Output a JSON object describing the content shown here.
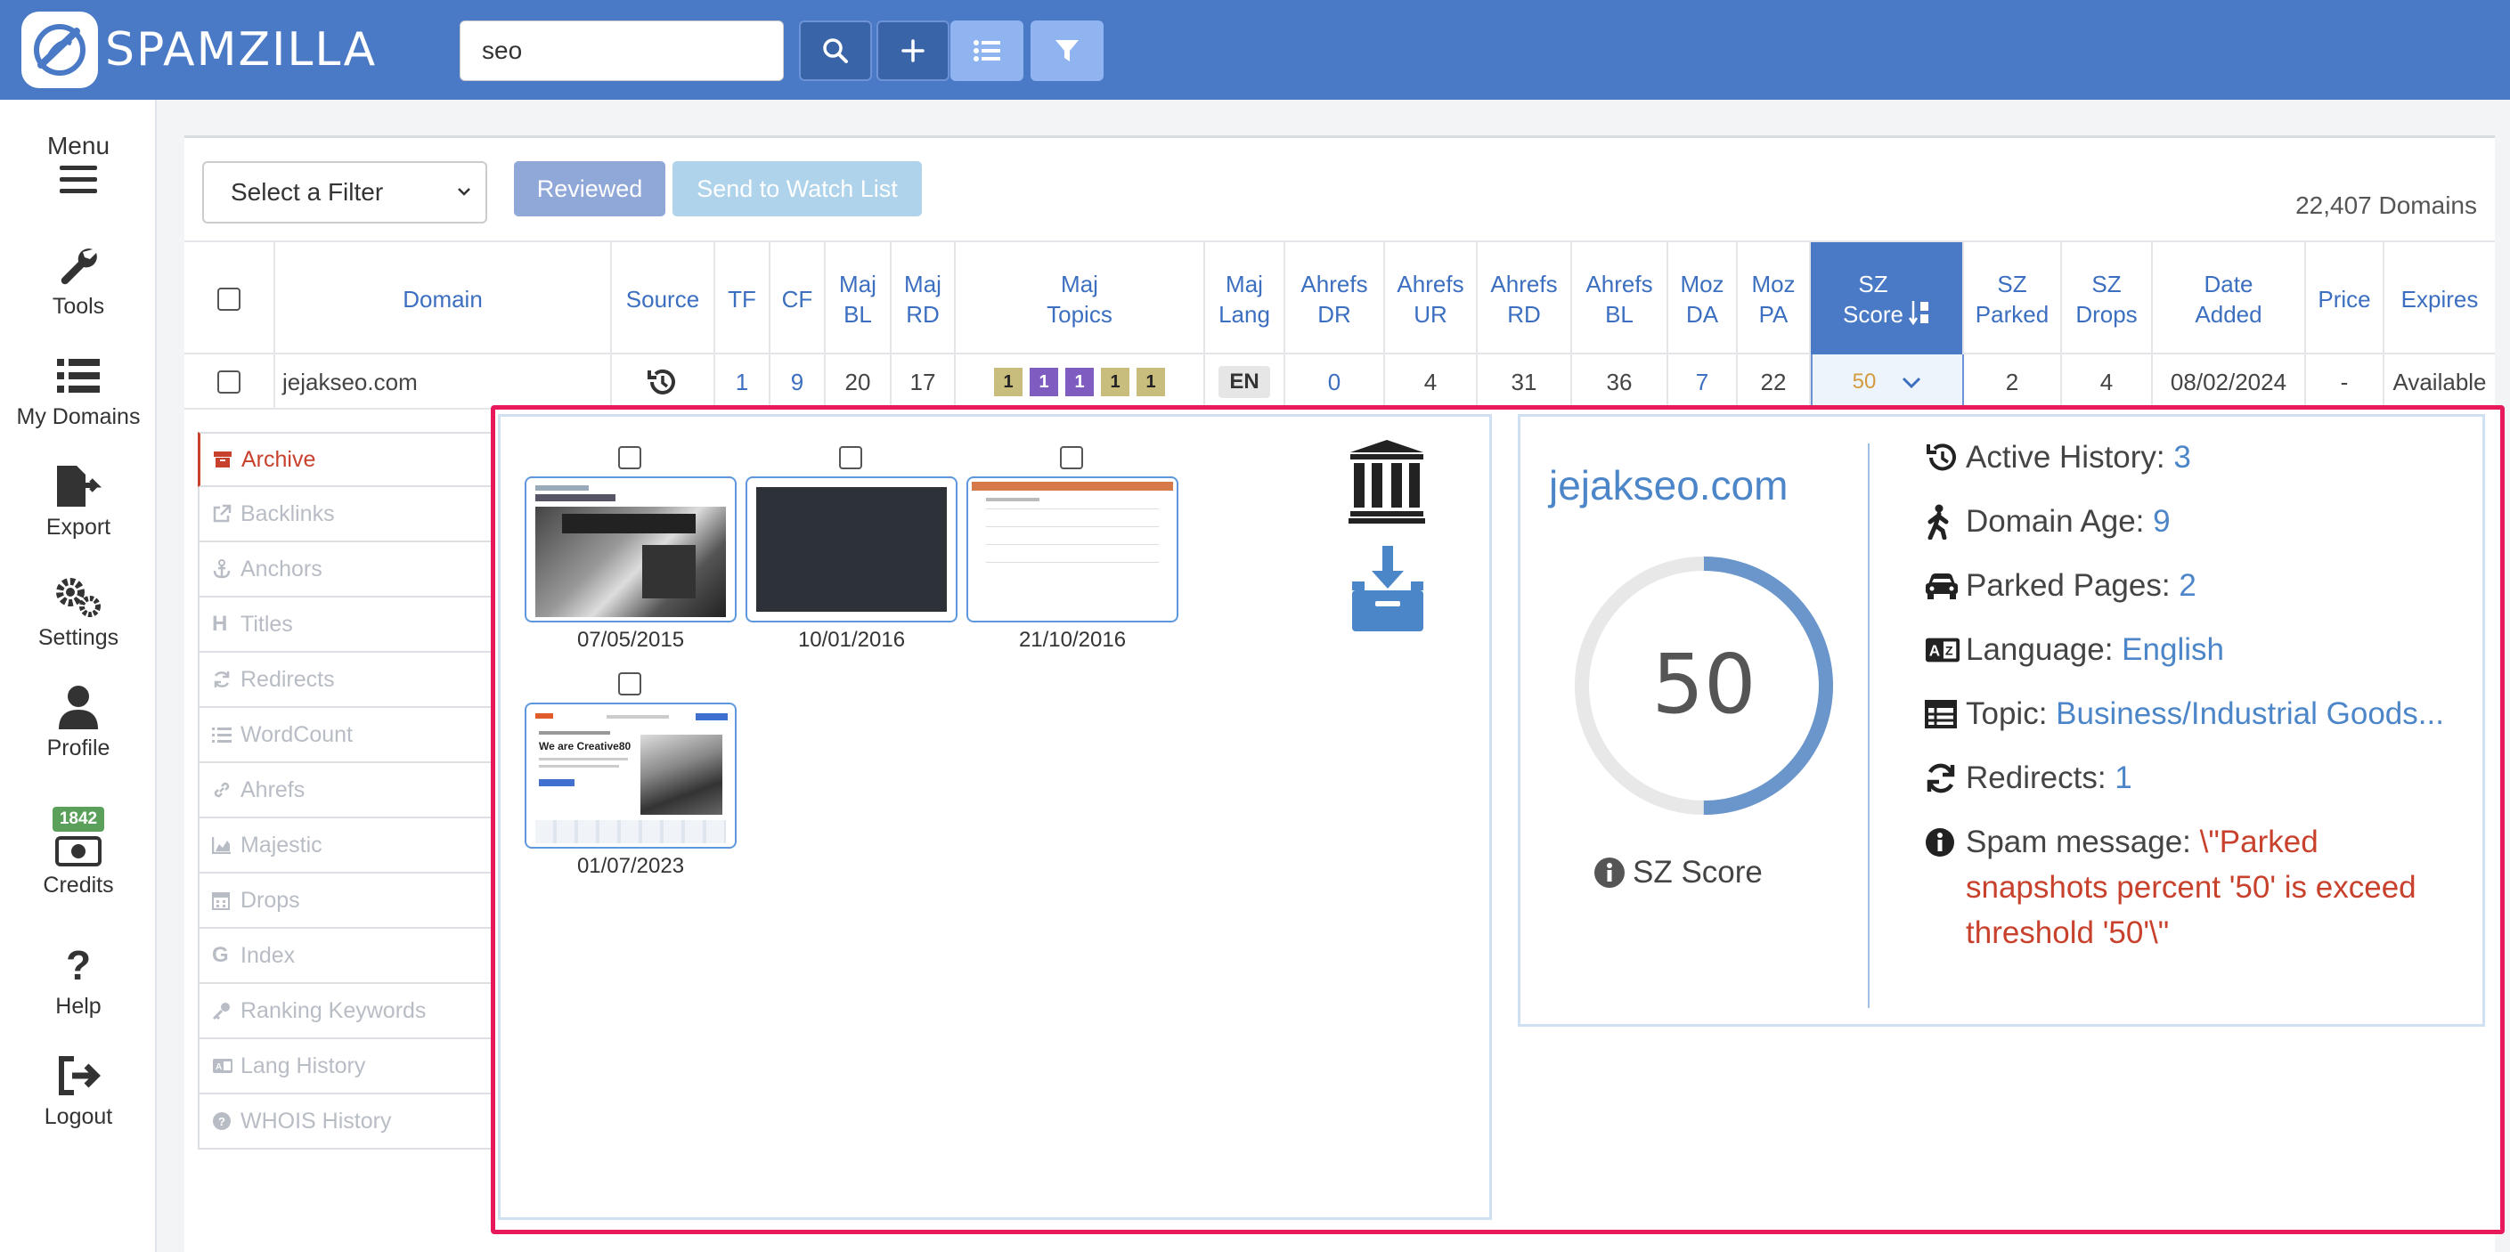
{
  "app": {
    "name": "SPAMZILLA"
  },
  "search": {
    "value": "seo"
  },
  "sidebar": {
    "menu": "Menu",
    "items": [
      {
        "label": "Tools"
      },
      {
        "label": "My Domains"
      },
      {
        "label": "Export"
      },
      {
        "label": "Settings"
      },
      {
        "label": "Profile"
      },
      {
        "label": "Credits",
        "badge": "1842"
      },
      {
        "label": "Help"
      },
      {
        "label": "Logout"
      }
    ]
  },
  "toolbar": {
    "filter_select": "Select a Filter",
    "reviewed": "Reviewed",
    "watch_list": "Send to Watch List",
    "domain_count": "22,407 Domains"
  },
  "table": {
    "headers": [
      "Domain",
      "Source",
      "TF",
      "CF",
      "Maj\nBL",
      "Maj\nRD",
      "Maj\nTopics",
      "Maj\nLang",
      "Ahrefs\nDR",
      "Ahrefs\nUR",
      "Ahrefs\nRD",
      "Ahrefs\nBL",
      "Moz\nDA",
      "Moz\nPA",
      "SZ\nScore",
      "SZ\nParked",
      "SZ\nDrops",
      "Date\nAdded",
      "Price",
      "Expires"
    ],
    "row": {
      "domain": "jejakseo.com",
      "tf": "1",
      "cf": "9",
      "maj_bl": "20",
      "maj_rd": "17",
      "topics": [
        "1",
        "1",
        "1",
        "1",
        "1"
      ],
      "lang": "EN",
      "ahrefs_dr": "0",
      "ahrefs_ur": "4",
      "ahrefs_rd": "31",
      "ahrefs_bl": "36",
      "moz_da": "7",
      "moz_pa": "22",
      "sz_score": "50",
      "sz_parked": "2",
      "sz_drops": "4",
      "date_added": "08/02/2024",
      "price": "-",
      "expires": "Available"
    }
  },
  "detail_tabs": [
    "Archive",
    "Backlinks",
    "Anchors",
    "Titles",
    "Redirects",
    "WordCount",
    "Ahrefs",
    "Majestic",
    "Drops",
    "Index",
    "Ranking Keywords",
    "Lang History",
    "WHOIS History"
  ],
  "archive": {
    "snapshots": [
      {
        "date": "07/05/2015"
      },
      {
        "date": "10/01/2016"
      },
      {
        "date": "21/10/2016"
      },
      {
        "date": "01/07/2023",
        "thumb_heading": "We are Creative80"
      }
    ]
  },
  "info": {
    "domain": "jejakseo.com",
    "score": "50",
    "score_fraction": 0.5,
    "score_label": "SZ Score",
    "rows": [
      {
        "label": "Active History: ",
        "value": "3"
      },
      {
        "label": "Domain Age: ",
        "value": "9"
      },
      {
        "label": "Parked Pages: ",
        "value": "2"
      },
      {
        "label": "Language: ",
        "value": "English"
      },
      {
        "label": "Topic: ",
        "value": "Business/Industrial Goods..."
      },
      {
        "label": "Redirects: ",
        "value": "1"
      },
      {
        "label": "Spam message: ",
        "value": "\\\"Parked snapshots percent '50' is exceed threshold '50'\\\""
      }
    ]
  },
  "colors": {
    "brand": "#4a79c6",
    "accent_red": "#c8412c",
    "highlight": "#e8195a"
  }
}
